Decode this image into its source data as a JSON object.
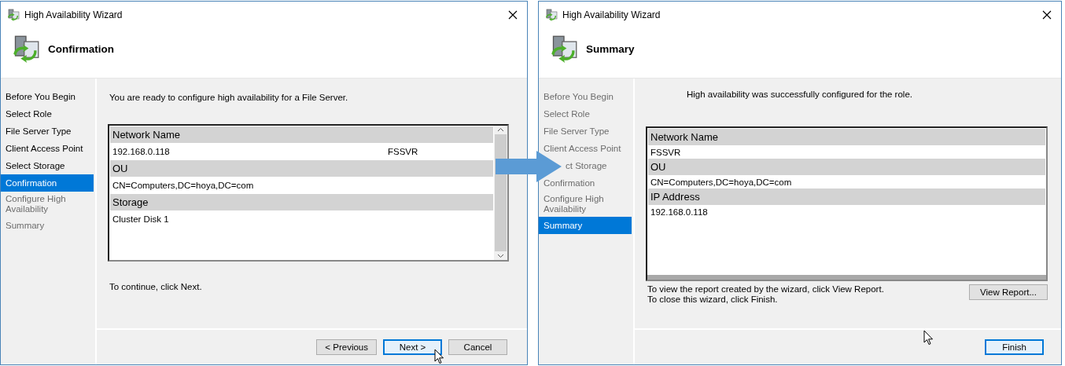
{
  "windows": [
    {
      "kind": "confirmation",
      "title": "High Availability Wizard",
      "page_title": "Confirmation",
      "steps": [
        {
          "label": "Before You Begin",
          "selected": false,
          "disabled": false
        },
        {
          "label": "Select Role",
          "selected": false,
          "disabled": false
        },
        {
          "label": "File Server Type",
          "selected": false,
          "disabled": false
        },
        {
          "label": "Client Access Point",
          "selected": false,
          "disabled": false
        },
        {
          "label": "Select Storage",
          "selected": false,
          "disabled": false
        },
        {
          "label": "Confirmation",
          "selected": true,
          "disabled": false
        },
        {
          "label": "Configure High Availability",
          "selected": false,
          "disabled": true
        },
        {
          "label": "Summary",
          "selected": false,
          "disabled": true
        }
      ],
      "intro": "You are ready to configure high availability for a File Server.",
      "details": [
        {
          "heading": "Network Name",
          "values": [
            "192.168.0.118",
            "FSSVR"
          ]
        },
        {
          "heading": "OU",
          "values": [
            "CN=Computers,DC=hoya,DC=com"
          ]
        },
        {
          "heading": "Storage",
          "values": [
            "Cluster Disk 1"
          ]
        }
      ],
      "footer_text": [
        "To continue, click Next."
      ],
      "buttons": [
        {
          "label": "< Previous",
          "default": false
        },
        {
          "label": "Next >",
          "default": true
        },
        {
          "label": "Cancel",
          "default": false
        }
      ]
    },
    {
      "kind": "summary",
      "title": "High Availability Wizard",
      "page_title": "Summary",
      "steps": [
        {
          "label": "Before You Begin",
          "selected": false,
          "disabled": true
        },
        {
          "label": "Select Role",
          "selected": false,
          "disabled": true
        },
        {
          "label": "File Server Type",
          "selected": false,
          "disabled": true
        },
        {
          "label": "Client Access Point",
          "selected": false,
          "disabled": true
        },
        {
          "label": "ct Storage",
          "selected": false,
          "disabled": true
        },
        {
          "label": "Confirmation",
          "selected": false,
          "disabled": true
        },
        {
          "label": "Configure High Availability",
          "selected": false,
          "disabled": true
        },
        {
          "label": "Summary",
          "selected": true,
          "disabled": false
        }
      ],
      "intro": "High availability was successfully configured for the role.",
      "details": [
        {
          "heading": "Network Name",
          "values": [
            "FSSVR"
          ]
        },
        {
          "heading": "OU",
          "values": [
            "CN=Computers,DC=hoya,DC=com"
          ]
        },
        {
          "heading": "IP Address",
          "values": [
            "192.168.0.118"
          ]
        }
      ],
      "footer_text": [
        "To view the report created by the wizard, click View Report.",
        "To close this wizard, click Finish."
      ],
      "report_button": "View Report...",
      "buttons": [
        {
          "label": "Finish",
          "default": true
        }
      ]
    }
  ]
}
